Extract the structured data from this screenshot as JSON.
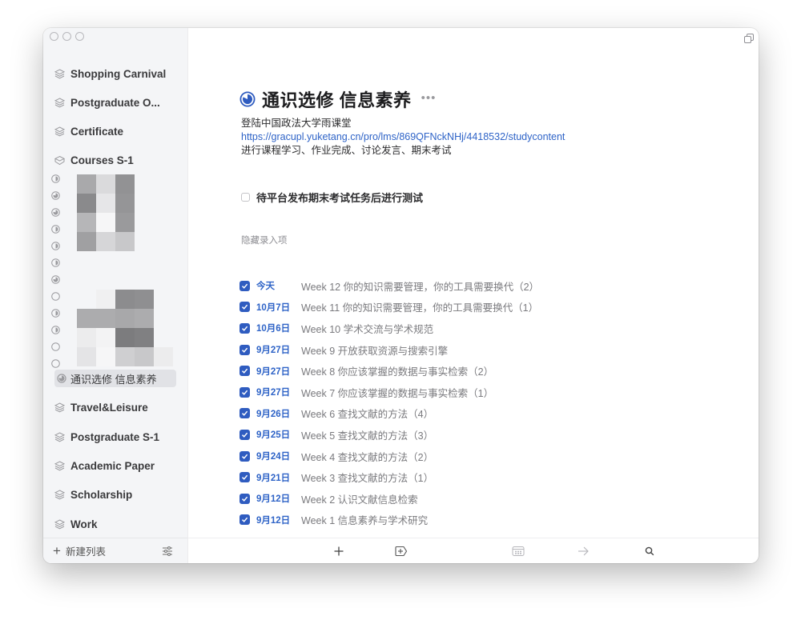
{
  "window": {
    "controls": [
      "close",
      "minimize",
      "zoom"
    ],
    "restore_icon": "restore-window-icon"
  },
  "sidebar": {
    "lists": [
      {
        "label": "Shopping Carnival",
        "icon": "stack-icon"
      },
      {
        "label": "Postgraduate O...",
        "icon": "stack-icon"
      },
      {
        "label": "Certificate",
        "icon": "stack-icon"
      },
      {
        "label": "Courses S-1",
        "icon": "folder-open-icon"
      }
    ],
    "sub_lists_redacted": [
      {
        "icon": "half-progress-icon"
      },
      {
        "icon": "pie-progress-icon"
      },
      {
        "icon": "pie-progress-icon"
      },
      {
        "icon": "half-progress-icon"
      },
      {
        "icon": "half-progress-icon"
      },
      {
        "icon": "half-progress-icon"
      },
      {
        "icon": "pie-progress-icon"
      },
      {
        "icon": "empty-progress-icon"
      },
      {
        "icon": "half-progress-icon"
      },
      {
        "icon": "half-progress-icon"
      },
      {
        "icon": "empty-progress-icon"
      },
      {
        "icon": "empty-progress-icon"
      }
    ],
    "selected": {
      "label": "通识选修 信息素养",
      "icon": "pie-progress-icon"
    },
    "lists_after": [
      {
        "label": "Travel&Leisure",
        "icon": "stack-icon"
      },
      {
        "label": "Postgraduate S-1",
        "icon": "stack-icon"
      },
      {
        "label": "Academic Paper",
        "icon": "stack-icon"
      },
      {
        "label": "Scholarship",
        "icon": "stack-icon"
      },
      {
        "label": "Work",
        "icon": "stack-icon"
      }
    ],
    "footer": {
      "new_list_label": "新建列表",
      "settings_icon": "sliders-icon"
    }
  },
  "main": {
    "title": "通识选修 信息素养",
    "title_icon": "progress-circle-icon",
    "more_label": "•••",
    "notes": {
      "line1": "登陆中国政法大学雨课堂",
      "link": "https://gracupl.yuketang.cn/pro/lms/869QFNckNHj/4418532/studycontent",
      "line3": "进行课程学习、作业完成、讨论发言、期末考试"
    },
    "pending_task": {
      "label": "待平台发布期末考试任务后进行测试",
      "checked": false
    },
    "hidden_label": "隐藏录入项",
    "completed": [
      {
        "date": "今天",
        "task": "Week 12 你的知识需要管理，你的工具需要换代（2）"
      },
      {
        "date": "10月7日",
        "task": "Week 11 你的知识需要管理，你的工具需要换代（1）"
      },
      {
        "date": "10月6日",
        "task": "Week 10 学术交流与学术规范"
      },
      {
        "date": "9月27日",
        "task": "Week 9 开放获取资源与搜索引擎"
      },
      {
        "date": "9月27日",
        "task": "Week 8 你应该掌握的数据与事实检索（2）"
      },
      {
        "date": "9月27日",
        "task": "Week 7 你应该掌握的数据与事实检索（1）"
      },
      {
        "date": "9月26日",
        "task": "Week 6 查找文献的方法（4）"
      },
      {
        "date": "9月25日",
        "task": "Week 5 查找文献的方法（3）"
      },
      {
        "date": "9月24日",
        "task": "Week 4 查找文献的方法（2）"
      },
      {
        "date": "9月21日",
        "task": "Week 3 查找文献的方法（1）"
      },
      {
        "date": "9月12日",
        "task": "Week 2 认识文献信息检索"
      },
      {
        "date": "9月12日",
        "task": "Week 1 信息素养与学术研究"
      }
    ],
    "toolbar": [
      {
        "name": "add-task-button",
        "icon": "plus-icon"
      },
      {
        "name": "add-heading-button",
        "icon": "tag-plus-icon"
      },
      {
        "name": "schedule-button",
        "icon": "calendar-icon"
      },
      {
        "name": "move-button",
        "icon": "arrow-right-icon"
      },
      {
        "name": "search-button",
        "icon": "search-icon"
      }
    ]
  },
  "colors": {
    "accent": "#2f5cc0",
    "link": "#2e63c7",
    "sidebar_bg": "#f4f5f7",
    "selected_bg": "#e1e2e6"
  }
}
